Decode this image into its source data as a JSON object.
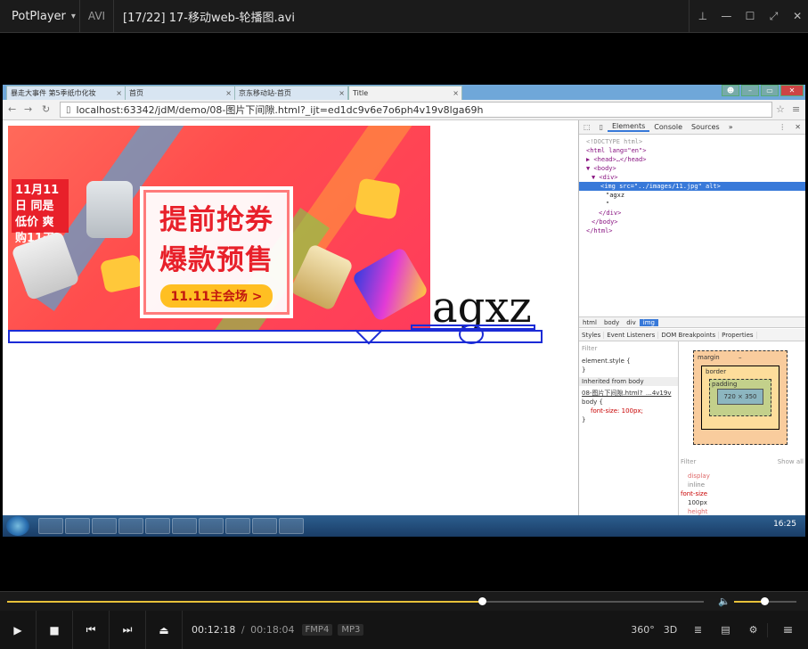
{
  "player": {
    "brand": "PotPlayer",
    "format": "AVI",
    "title": "[17/22] 17-移动web-轮播图.avi"
  },
  "browser": {
    "tabs": [
      {
        "label": "暴走大事件 第5季纸巾化妆"
      },
      {
        "label": "首页"
      },
      {
        "label": "京东移动站-首页"
      },
      {
        "label": "Title"
      }
    ],
    "url": "localhost:63342/jdM/demo/08-图片下间隙.html?_ijt=ed1dc9v6e7o6ph4v19v8lga69h"
  },
  "page": {
    "banner_logo": "11月11日 同是低价 爽购11天",
    "banner_line1": "提前抢券",
    "banner_line2": "爆款预售",
    "banner_button": "11.11主会场 >",
    "text": "agxz"
  },
  "devtools": {
    "tabs": [
      "Elements",
      "Console",
      "Sources",
      "»"
    ],
    "dom": [
      "<!DOCTYPE html>",
      "<html lang=\"en\">",
      "▶ <head>…</head>",
      "▼ <body>",
      "  ▼ <div>",
      "      <img src=\"../images/11.jpg\" alt>",
      "      \"agxz",
      "      \"",
      "    </div>",
      "  </body>",
      "</html>"
    ],
    "selected_index": 5,
    "breadcrumbs": [
      "html",
      "body",
      "div",
      "img"
    ],
    "style_tabs": [
      "Styles",
      "Event Listeners",
      "DOM Breakpoints",
      "Properties"
    ],
    "styles": {
      "filter": "Filter",
      "element_style": "element.style {",
      "close": "}",
      "inherited": "Inherited from body",
      "source": "08-图片下间隙.html?_…4v19v",
      "rule": "body {",
      "prop": "font-size: 100px;"
    },
    "boxmodel": {
      "margin": "margin",
      "border": "border",
      "padding": "padding",
      "content": "720 × 350",
      "dash": "–"
    },
    "computed": {
      "filter": "Filter",
      "show_all": "Show all",
      "props": [
        "display",
        "inline",
        "font-size",
        "100px",
        "height"
      ]
    }
  },
  "taskbar": {
    "clock": "16:25"
  },
  "playback": {
    "current": "00:12:18",
    "separator": "/",
    "duration": "00:18:04",
    "tags": [
      "FMP4",
      "MP3"
    ],
    "progress": 0.682,
    "volume": 0.48
  },
  "colors": {
    "seek": "#e7c13a",
    "accent_blue": "#3879d9"
  }
}
